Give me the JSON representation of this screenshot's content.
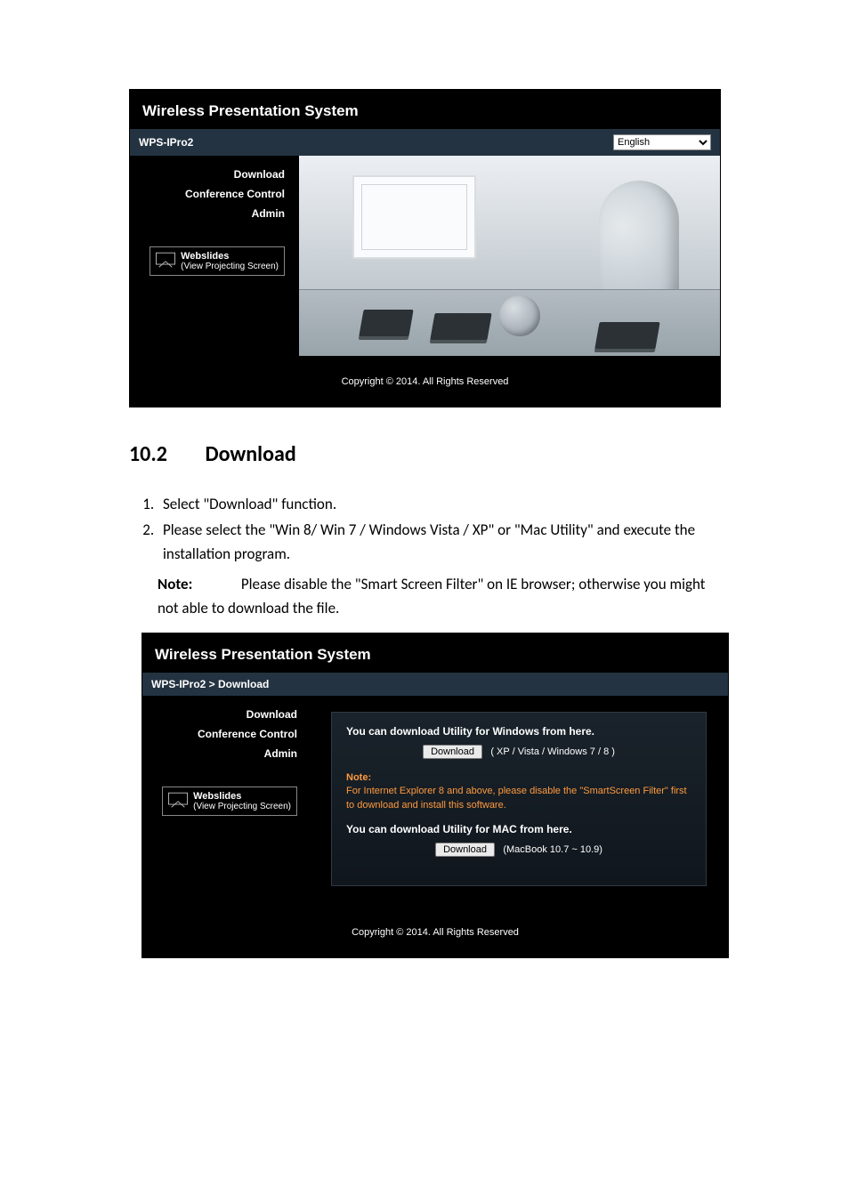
{
  "ss1": {
    "system_title": "Wireless Presentation System",
    "product": "WPS-IPro2",
    "lang_selected": "English",
    "nav": {
      "download": "Download",
      "conference": "Conference Control",
      "admin": "Admin",
      "webslides_title": "Webslides",
      "webslides_sub": "(View Projecting Screen)"
    },
    "copyright": "Copyright © 2014. All Rights Reserved"
  },
  "section": {
    "num": "10.2",
    "title": "Download"
  },
  "steps": {
    "s1": "Select \"Download\" function.",
    "s2": "Please select the \"Win 8/ Win 7 / Windows Vista / XP\" or \"Mac Utility\" and execute the installation program."
  },
  "note": {
    "label": "Note:",
    "text": "Please disable the \"Smart Screen Filter\" on IE browser; otherwise you might not able to download the file."
  },
  "ss2": {
    "system_title": "Wireless Presentation System",
    "breadcrumb": "WPS-IPro2 > Download",
    "nav": {
      "download": "Download",
      "conference": "Conference Control",
      "admin": "Admin",
      "webslides_title": "Webslides",
      "webslides_sub": "(View Projecting Screen)"
    },
    "panel": {
      "win_heading": "You can download Utility for Windows from here.",
      "btn": "Download",
      "win_os": "( XP / Vista / Windows 7 / 8 )",
      "warn_title": "Note:",
      "warn_text": "For Internet Explorer 8 and above, please disable the \"SmartScreen Filter\" first to download and install this software.",
      "mac_heading": "You can download Utility for MAC from here.",
      "mac_os": "(MacBook 10.7 ~ 10.9)"
    },
    "copyright": "Copyright © 2014. All Rights Reserved"
  }
}
